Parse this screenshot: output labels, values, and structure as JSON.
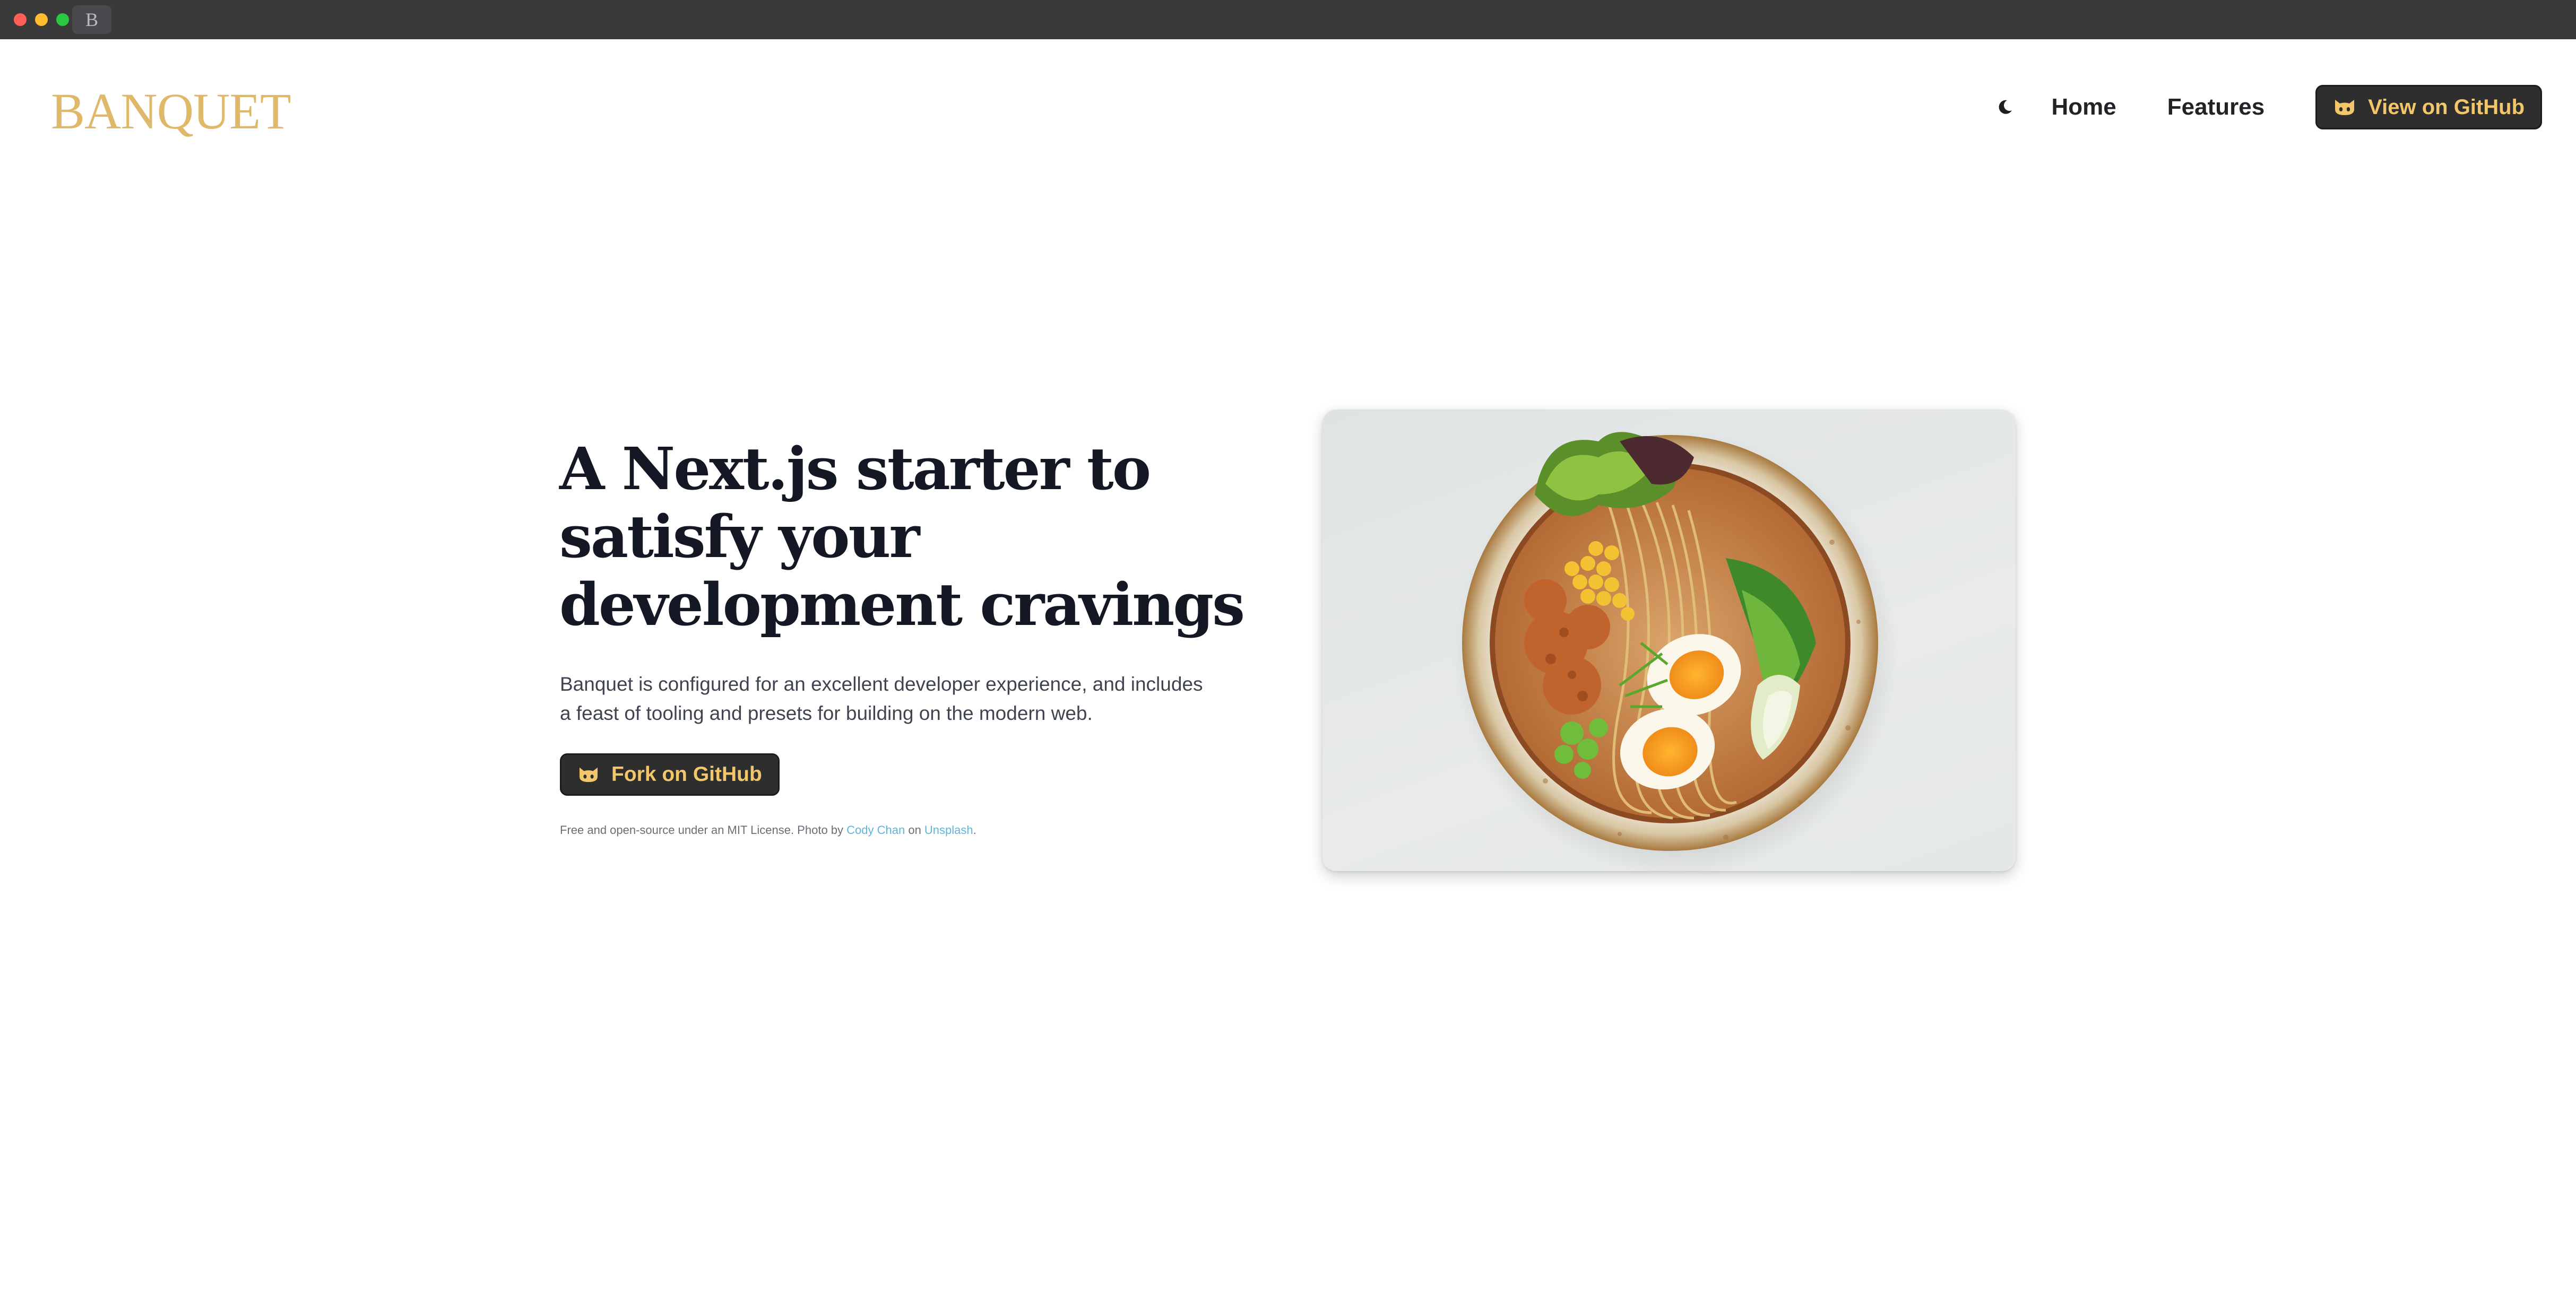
{
  "browser": {
    "tab_glyph": "B"
  },
  "header": {
    "logo": "BANQUET",
    "theme_icon": "moon-icon",
    "nav": {
      "home": "Home",
      "features": "Features"
    },
    "github_button": "View on GitHub"
  },
  "hero": {
    "headline": "A Next.js starter to satisfy your development cravings",
    "description": "Banquet is configured for an excellent developer experience, and includes a feast of tooling and presets for building on the modern web.",
    "fork_button": "Fork on GitHub",
    "footnote": {
      "prefix": "Free and open-source under an MIT License. Photo by ",
      "photographer": "Cody Chan",
      "middle": " on ",
      "source": "Unsplash",
      "suffix": "."
    }
  },
  "colors": {
    "accent_gold": "#e0b869",
    "button_text": "#f2c66b",
    "button_bg": "#2e2e2e",
    "headline": "#141824",
    "link": "#5eb5d9"
  }
}
